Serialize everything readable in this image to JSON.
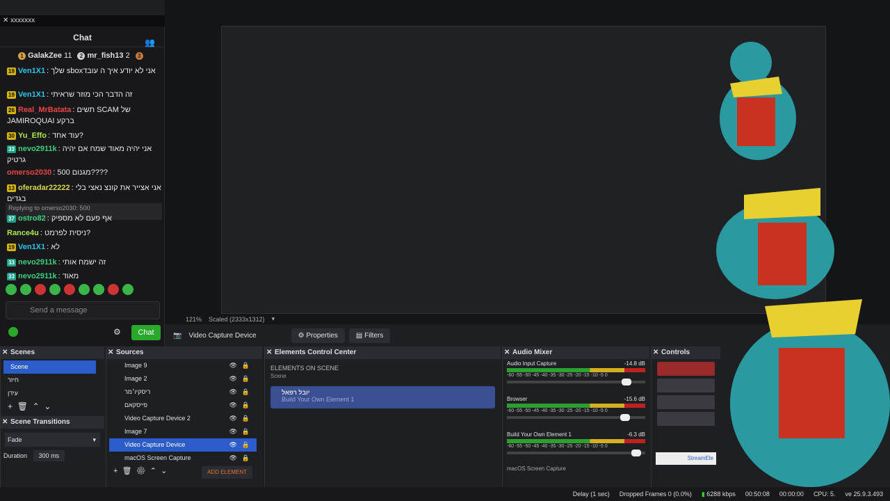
{
  "window": {
    "title": "xxxxxxx"
  },
  "chat": {
    "header": "Chat",
    "users_icon": "users-icon",
    "top": [
      {
        "medal": "1",
        "name": "GalakZee",
        "count": "11"
      },
      {
        "medal": "2",
        "name": "mr_fish13",
        "count": "2"
      },
      {
        "medal": "3",
        "name": "",
        "count": ""
      }
    ],
    "messages": [
      {
        "badge": "19",
        "name": "Ven1X1",
        "color": "#2ec4e8",
        "text": "שלך sboxאני לא יודע איך ה עובד"
      },
      {
        "badge": "19",
        "name": "Ven1X1",
        "color": "#2ec4e8",
        "text": "זה הדבר הכי מוזר שראיתי"
      },
      {
        "badge": "26",
        "name": "Real_MrBatata",
        "color": "#e84545",
        "text": "תשים SCAM של JAMIROQUAI ברקע"
      },
      {
        "badge": "30",
        "name": "Yu_Effo",
        "color": "#a9e84b",
        "text": "עוד אחד?"
      },
      {
        "badge": "33",
        "name": "nevo2911k",
        "color": "#3ad17d",
        "text": "אני יהיה מאוד שמח אם יהיה גרטיק"
      },
      {
        "badge": "",
        "name": "omerso2030",
        "color": "#e84545",
        "text": "500 מגנום????"
      },
      {
        "badge": "13",
        "name": "oferadar22222",
        "color": "#d6d64a",
        "text": "אני אצייר את קונצ נאצי בלי בגדים"
      },
      {
        "badge": "37",
        "name": "ostro82",
        "color": "#3ad17d",
        "text": "אף פעם לא מספיק"
      },
      {
        "badge": "",
        "name": "Rance4u",
        "color": "#a9e84b",
        "text": "ניסית לפרמט?"
      },
      {
        "badge": "19",
        "name": "Ven1X1",
        "color": "#2ec4e8",
        "text": "לא"
      },
      {
        "badge": "33",
        "name": "nevo2911k",
        "color": "#3ad17d",
        "text": "זה ישמח אותי"
      },
      {
        "badge": "33",
        "name": "nevo2911k",
        "color": "#3ad17d",
        "text": "מאוד"
      }
    ],
    "reply_hint": "Replying to omerso2030: 500",
    "input_placeholder": "Send a message",
    "send_label": "Chat"
  },
  "preview": {
    "zoom": "121%",
    "scaled": "Scaled (2333x1312)"
  },
  "toolbar": {
    "source": "Video Capture Device",
    "properties": "Properties",
    "filters": "Filters"
  },
  "scenes": {
    "title": "Scenes",
    "items": [
      "Scene",
      "חיזר",
      "עידן"
    ]
  },
  "transitions": {
    "title": "Scene Transitions",
    "value": "Fade",
    "duration_label": "Duration",
    "duration": "300 ms"
  },
  "sources": {
    "title": "Sources",
    "items": [
      "Image 9",
      "Image 2",
      "ריסקיו׳מר",
      "פייסקאם",
      "Video Capture Device 2",
      "Image 7",
      "Video Capture Device",
      "macOS Screen Capture"
    ],
    "add_element": "ADD ELEMENT"
  },
  "elements": {
    "title": "Elements Control Center",
    "heading": "ELEMENTS ON SCENE",
    "sub": "Scene",
    "card_title": "יובל רפאל",
    "card_sub": "Build Your Own Element 1"
  },
  "mixer": {
    "title": "Audio Mixer",
    "channels": [
      {
        "name": "Audio Input Capture",
        "db": "-14.8 dB",
        "vol": 0.83
      },
      {
        "name": "Browser",
        "db": "-15.6 dB",
        "vol": 0.82
      },
      {
        "name": "Build Your Own Element 1",
        "db": "-6.3 dB",
        "vol": 0.9
      }
    ],
    "ticks": "-60 -55 -50 -45 -40 -35 -30 -25 -20 -15 -10 -5 0",
    "last": "macOS Screen Capture"
  },
  "controls": {
    "title": "Controls",
    "footer": "StreamEle"
  },
  "status": {
    "delay": "Delay (1 sec)",
    "dropped": "Dropped Frames 0 (0.0%)",
    "kbps": "6288 kbps",
    "time1": "00:50:08",
    "time2": "00:00:00",
    "cpu": "CPU: 5.",
    "version": "ve 25.9.3.493"
  },
  "colors": {
    "accent": "#2b5cc9",
    "send": "#2aa82c"
  }
}
